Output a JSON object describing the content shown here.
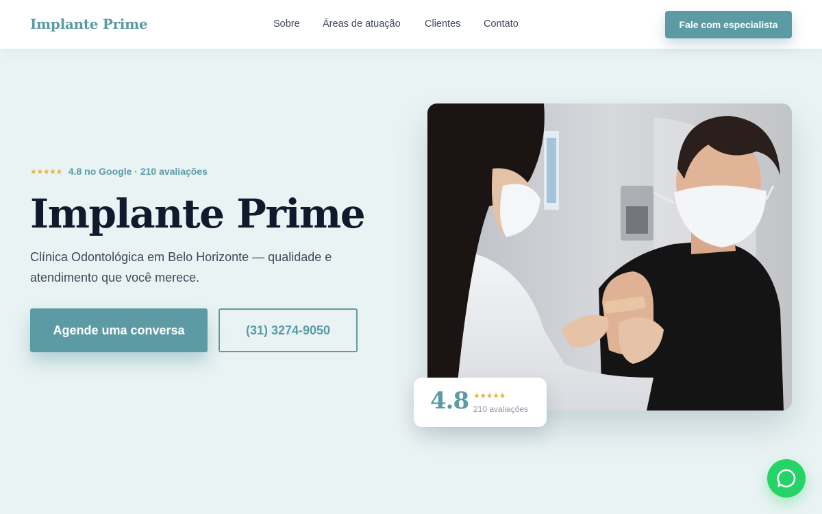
{
  "header": {
    "logo": "Implante Prime",
    "nav": [
      "Sobre",
      "Áreas de atuação",
      "Clientes",
      "Contato"
    ],
    "cta_label": "Fale com especialista"
  },
  "hero": {
    "stars": "★★★★★",
    "rating_text": "4.8 no Google · 210 avaliações",
    "title": "Implante Prime",
    "subtitle": "Clínica Odontológica em Belo Horizonte — qualidade e atendimento que você merece.",
    "primary_button": "Agende uma conversa",
    "secondary_button": "(31) 3274-9050"
  },
  "rating_card": {
    "score": "4.8",
    "stars": "★★★★★",
    "count": "210 avaliações"
  },
  "icons": {
    "whatsapp": "whatsapp-icon"
  },
  "colors": {
    "accent": "#5d9ba4",
    "star": "#e8b51f",
    "whatsapp": "#25d366",
    "background": "#eaf3f4"
  }
}
